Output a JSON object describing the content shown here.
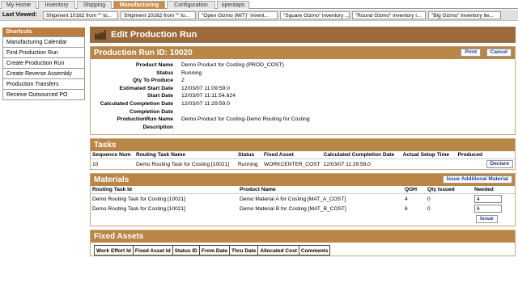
{
  "tabs": [
    {
      "label": "My Home",
      "active": false
    },
    {
      "label": "Inventory",
      "active": false
    },
    {
      "label": "Shipping",
      "active": false
    },
    {
      "label": "Manufacturing",
      "active": true
    },
    {
      "label": "Configuration",
      "active": false
    },
    {
      "label": "opentaps",
      "active": false
    }
  ],
  "last_viewed": {
    "label": "Last Viewed:",
    "items": [
      "Shipment 10162 from \"\" to...",
      "Shipment 10162 from \"\" to...",
      "\"Open Gizmo (MIT)\" invent...",
      "\"Square Gizmo\" inventory ...",
      "\"Round Gizmo\" inventory i...",
      "\"Big Gizmo\" inventory ite..."
    ]
  },
  "shortcuts": {
    "title": "Shortcuts",
    "items": [
      "Manufacturing Calendar",
      "Find Production Run",
      "Create Production Run",
      "Create Reverse Assembly",
      "Production Transfers",
      "Receive Outsourced PO"
    ]
  },
  "page_title": "Edit Production Run",
  "run": {
    "header": "Production Run ID: 10020",
    "print_label": "Print",
    "cancel_label": "Cancel",
    "fields": [
      {
        "label": "Product Name",
        "value": "Demo Product for Costing (PROD_COST)"
      },
      {
        "label": "Status",
        "value": "Running"
      },
      {
        "label": "Qty To Produce",
        "value": "2"
      },
      {
        "label": "Estimated Start Date",
        "value": "12/03/07 11:09:59.0"
      },
      {
        "label": "Start Date",
        "value": "12/03/07 11:11:54.824"
      },
      {
        "label": "Calculated Completion Date",
        "value": "12/03/07 11:29:59.0"
      },
      {
        "label": "Completion Date",
        "value": ""
      },
      {
        "label": "ProductionRun Name",
        "value": "Demo Product for Costing-Demo Routing for Costing"
      },
      {
        "label": "Description",
        "value": ""
      }
    ]
  },
  "tasks": {
    "title": "Tasks",
    "columns": {
      "seq": "Sequence Num",
      "name": "Routing Task Name",
      "status": "Status",
      "asset": "Fixed Asset",
      "completion": "Calculated Completion Date",
      "setup": "Actual Setup Time",
      "produced": "Produced"
    },
    "rows": [
      {
        "seq": "10",
        "name": "Demo Routing Task for Costing [10021]",
        "status": "Running",
        "asset": "WORKCENTER_COST",
        "completion": "12/03/07 11:29:59.0",
        "setup": "",
        "produced": "",
        "action": "Declare"
      }
    ]
  },
  "materials": {
    "title": "Materials",
    "issue_additional_label": "Issue Additional Material",
    "columns": {
      "task": "Routing Task Id",
      "product": "Product Name",
      "qoh": "QOH",
      "issued": "Qty Issued",
      "needed": "Needed"
    },
    "rows": [
      {
        "task": "Demo Routing Task for Costing [10021]",
        "product": "Demo Material A for Costing [MAT_A_COST]",
        "qoh": "4",
        "issued": "0",
        "needed": "4"
      },
      {
        "task": "Demo Routing Task for Costing [10021]",
        "product": "Demo Material B for Costing [MAT_B_COST]",
        "qoh": "6",
        "issued": "0",
        "needed": "6"
      }
    ],
    "issue_label": "Issue"
  },
  "fixed_assets": {
    "title": "Fixed Assets",
    "columns": [
      "Work Effort Id",
      "Fixed Asset Id",
      "Status ID",
      "From Date",
      "Thru Date",
      "Allocated Cost",
      "Comments"
    ]
  },
  "colors": {
    "brand": "#9b6b3d",
    "section_header": "#b98648",
    "active_tab": "#c98e48"
  }
}
